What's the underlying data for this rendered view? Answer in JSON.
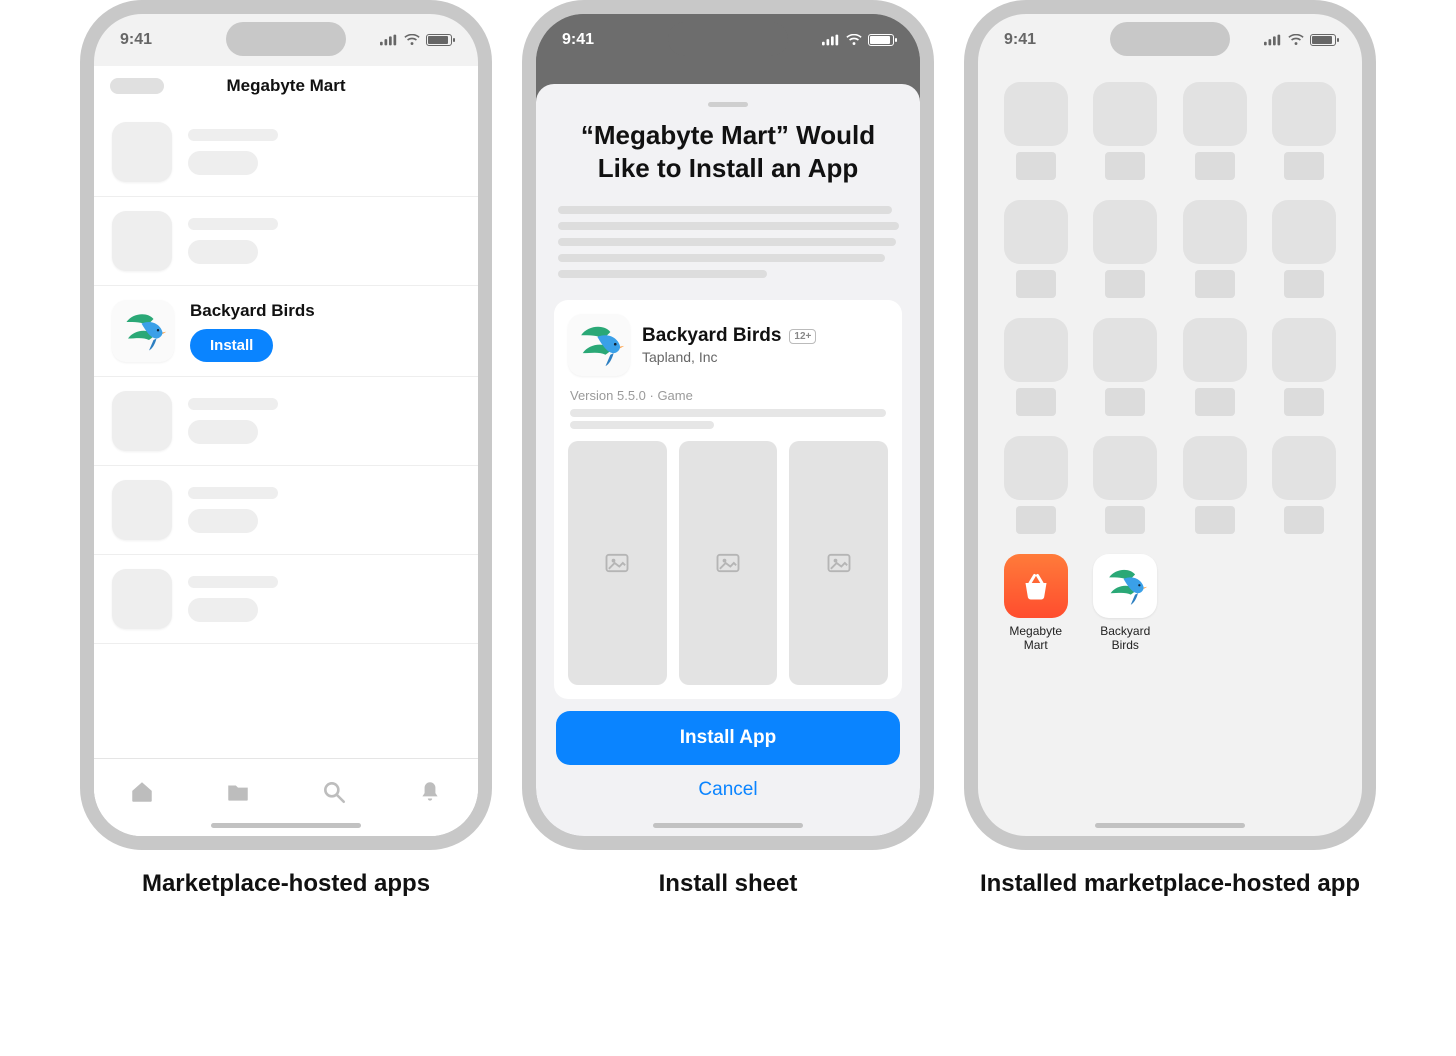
{
  "statusbar": {
    "time": "9:41"
  },
  "screen1": {
    "header_title": "Megabyte Mart",
    "app_name": "Backyard Birds",
    "install_label": "Install"
  },
  "screen2": {
    "title": "“Megabyte Mart” Would Like to Install an App",
    "app_name": "Backyard Birds",
    "developer": "Tapland, Inc",
    "age_rating": "12+",
    "meta": "Version 5.5.0 · Game",
    "primary": "Install App",
    "secondary": "Cancel"
  },
  "screen3": {
    "apps": {
      "megabyte_mart": "Megabyte Mart",
      "backyard_birds": "Backyard Birds"
    }
  },
  "captions": {
    "c1": "Marketplace-hosted apps",
    "c2": "Install sheet",
    "c3": "Installed marketplace-hosted app"
  }
}
